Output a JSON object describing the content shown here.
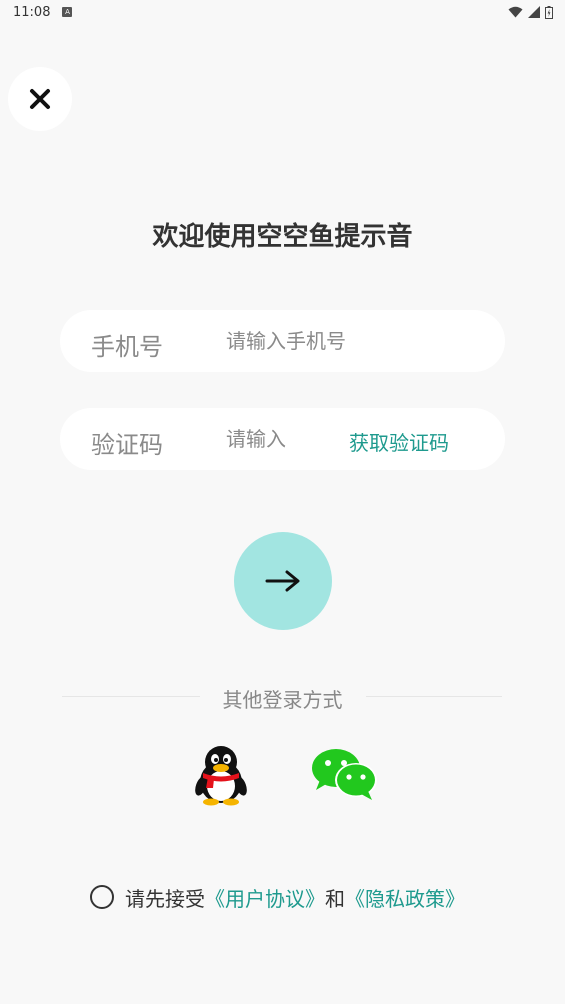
{
  "status_bar": {
    "time": "11:08",
    "notification_icon": "A"
  },
  "title": "欢迎使用空空鱼提示音",
  "phone_field": {
    "label": "手机号",
    "placeholder": "请输入手机号",
    "value": ""
  },
  "code_field": {
    "label": "验证码",
    "placeholder": "请输入",
    "value": "",
    "get_code_label": "获取验证码"
  },
  "submit": {
    "icon": "arrow-right-icon"
  },
  "other_login": {
    "label": "其他登录方式",
    "methods": [
      {
        "name": "QQ",
        "icon": "qq-penguin-icon"
      },
      {
        "name": "WeChat",
        "icon": "wechat-icon"
      }
    ]
  },
  "agreement": {
    "prefix": "请先接受",
    "user_agreement": "《用户协议》",
    "conjunction": "和",
    "privacy_policy": "《隐私政策》",
    "checked": false
  },
  "colors": {
    "accent": "#1e9a8e",
    "submit_bg": "#a2e5e1",
    "background": "#f8f8f8",
    "wechat": "#22c81e"
  }
}
